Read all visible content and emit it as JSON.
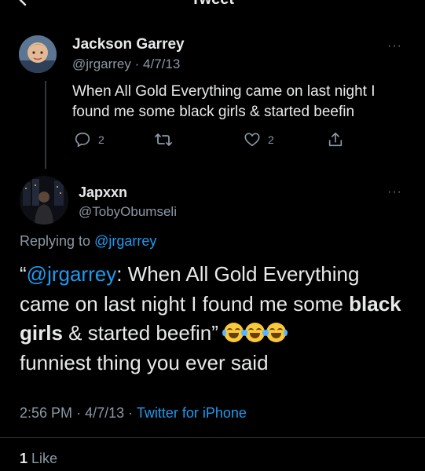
{
  "header": {
    "title": "Tweet"
  },
  "parent_tweet": {
    "display_name": "Jackson Garrey",
    "handle": "@jrgarrey",
    "separator": "·",
    "date": "4/7/13",
    "text": "When All Gold Everything came on last night I found me some black girls & started beefin",
    "reply_count": "2",
    "like_count": "2",
    "more_label": "···"
  },
  "main_tweet": {
    "display_name": "Japxxn",
    "handle": "@TobyObumseli",
    "more_label": "···",
    "replying_to_prefix": "Replying to",
    "replying_to_handle": "@jrgarrey",
    "text_open_quote": "“",
    "text_mention": "@jrgarrey",
    "text_part1": ": When All Gold Everything came on last night I found me some ",
    "text_bold": "black girls",
    "text_part2": " & started beefin” ",
    "text_part3": "funniest thing you ever said",
    "emoji": "tears-of-joy x3",
    "time": "2:56 PM",
    "date": "4/7/13",
    "separator": "·",
    "source": "Twitter for iPhone"
  },
  "stats": {
    "like_count": "1",
    "like_label": "Like"
  },
  "colors": {
    "background": "#000000",
    "text": "#e7e9ea",
    "muted": "#8b98a5",
    "link": "#1d9bf0"
  }
}
